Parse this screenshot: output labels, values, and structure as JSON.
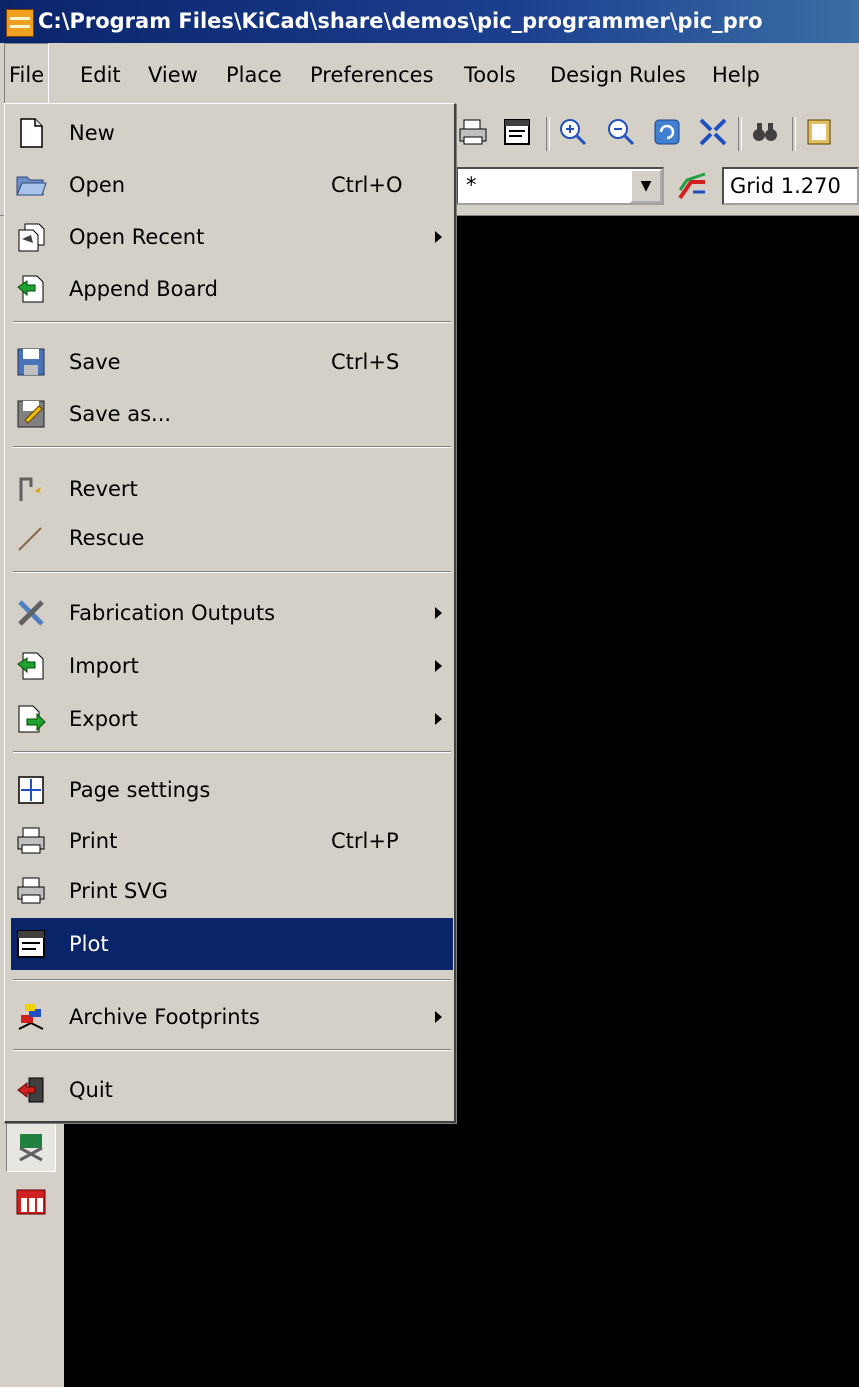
{
  "window": {
    "title": "C:\\Program Files\\KiCad\\share\\demos\\pic_programmer\\pic_pro"
  },
  "menubar": {
    "items": [
      "File",
      "Edit",
      "View",
      "Place",
      "Preferences",
      "Tools",
      "Design Rules",
      "Help"
    ],
    "active": "File"
  },
  "toolbar": {
    "layer_combo_value": "*",
    "grid_value": "Grid 1.270"
  },
  "file_menu": {
    "items": [
      {
        "label": "New",
        "accel": "",
        "submenu": false,
        "icon": "new-document-icon"
      },
      {
        "label": "Open",
        "accel": "Ctrl+O",
        "submenu": false,
        "icon": "open-folder-icon"
      },
      {
        "label": "Open Recent",
        "accel": "",
        "submenu": true,
        "icon": "open-recent-icon"
      },
      {
        "label": "Append Board",
        "accel": "",
        "submenu": false,
        "icon": "append-board-icon"
      },
      {
        "label": "Save",
        "accel": "Ctrl+S",
        "submenu": false,
        "icon": "save-icon"
      },
      {
        "label": "Save as...",
        "accel": "",
        "submenu": false,
        "icon": "save-as-icon"
      },
      {
        "label": "Revert",
        "accel": "",
        "submenu": false,
        "icon": "revert-icon"
      },
      {
        "label": "Rescue",
        "accel": "",
        "submenu": false,
        "icon": "rescue-icon"
      },
      {
        "label": "Fabrication Outputs",
        "accel": "",
        "submenu": true,
        "icon": "fabrication-tools-icon"
      },
      {
        "label": "Import",
        "accel": "",
        "submenu": true,
        "icon": "import-icon"
      },
      {
        "label": "Export",
        "accel": "",
        "submenu": true,
        "icon": "export-icon"
      },
      {
        "label": "Page settings",
        "accel": "",
        "submenu": false,
        "icon": "page-settings-icon"
      },
      {
        "label": "Print",
        "accel": "Ctrl+P",
        "submenu": false,
        "icon": "printer-icon"
      },
      {
        "label": "Print SVG",
        "accel": "",
        "submenu": false,
        "icon": "printer-svg-icon"
      },
      {
        "label": "Plot",
        "accel": "",
        "submenu": false,
        "icon": "plot-icon",
        "highlighted": true
      },
      {
        "label": "Archive Footprints",
        "accel": "",
        "submenu": true,
        "icon": "archive-footprints-icon"
      },
      {
        "label": "Quit",
        "accel": "",
        "submenu": false,
        "icon": "quit-icon"
      }
    ]
  },
  "colors": {
    "menu_bg": "#d4d0c8",
    "highlight_bg": "#0a246a",
    "title_bg": "#0a246a",
    "canvas_bg": "#000000"
  }
}
